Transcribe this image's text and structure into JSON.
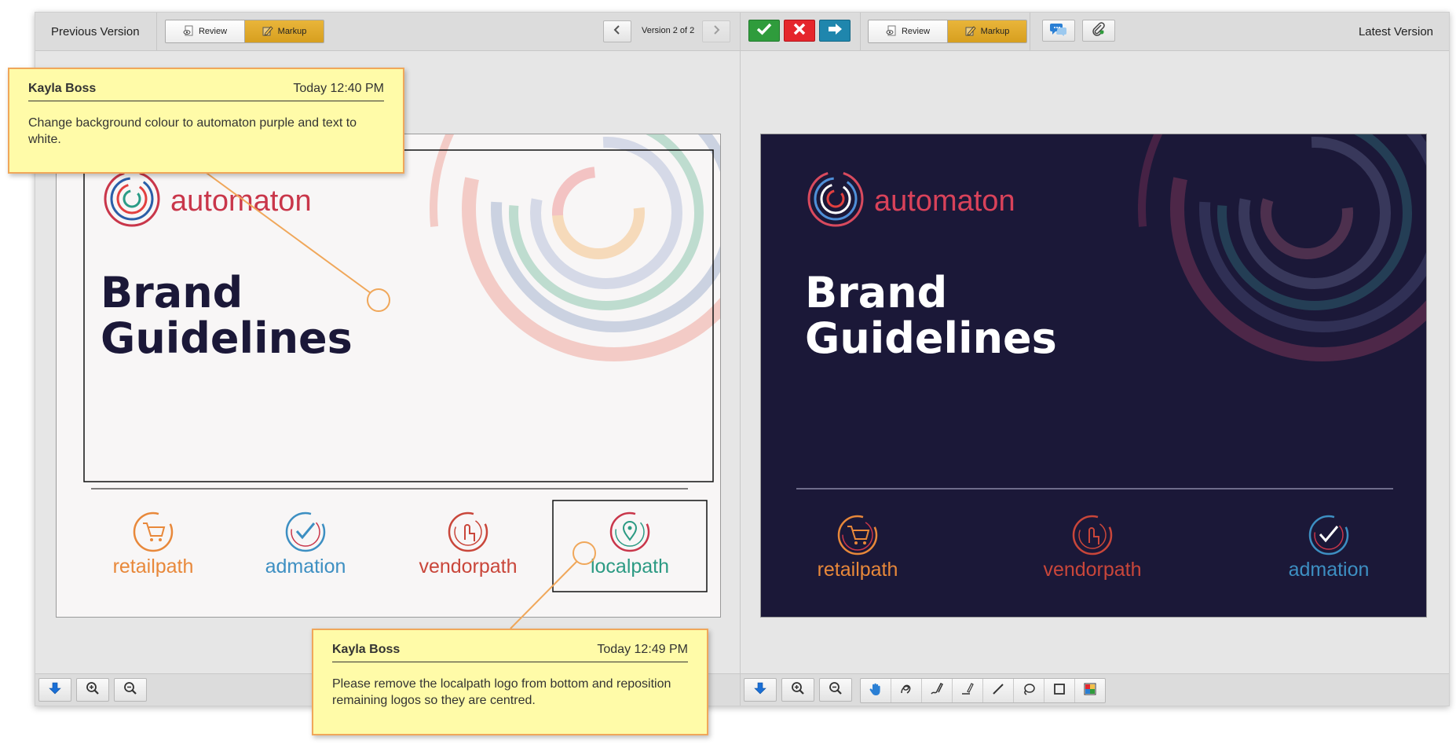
{
  "left_pane": {
    "title": "Previous Version",
    "review_label": "Review",
    "markup_label": "Markup",
    "version_label": "Version 2 of 2"
  },
  "right_pane": {
    "title": "Latest Version",
    "review_label": "Review",
    "markup_label": "Markup"
  },
  "artwork_previous": {
    "brand": "automaton",
    "heading_line1": "Brand",
    "heading_line2": "Guidelines",
    "logos": [
      "retailpath",
      "admation",
      "vendorpath",
      "localpath"
    ]
  },
  "artwork_latest": {
    "brand": "automaton",
    "heading_line1": "Brand",
    "heading_line2": "Guidelines",
    "logos": [
      "retailpath",
      "vendorpath",
      "admation"
    ]
  },
  "comments": [
    {
      "author": "Kayla Boss",
      "time": "Today 12:40 PM",
      "text": "Change background colour to automaton purple and text to white."
    },
    {
      "author": "Kayla Boss",
      "time": "Today 12:49 PM",
      "text": "Please remove the localpath logo from bottom and reposition remaining logos so they are centred."
    }
  ],
  "colors": {
    "markup_active": "#d9a120",
    "approve": "#2f9c3c",
    "reject": "#e5262c",
    "next": "#1f86ad",
    "note_bg": "#fffba8",
    "note_border": "#f0a75a",
    "automaton_purple": "#1b1838",
    "retailpath": "#e8883a",
    "admation": "#3d8fc2",
    "vendorpath": "#c9463a",
    "localpath": "#2c9a83"
  },
  "icons": {
    "review": "eye-page-icon",
    "markup": "pencil-icon",
    "prev": "chevron-left-icon",
    "next_version": "chevron-right-icon",
    "approve": "checkmark-icon",
    "reject": "x-icon",
    "send": "arrow-right-icon",
    "comments": "chat-bubbles-icon",
    "attach": "paperclip-icon",
    "download": "download-arrow-icon",
    "zoom_in": "zoom-in-icon",
    "zoom_out": "zoom-out-icon",
    "pan": "hand-icon",
    "freehand": "freehand-icon",
    "pen": "pen-icon",
    "highlighter": "highlighter-icon",
    "line": "line-icon",
    "lasso": "lasso-icon",
    "rectangle": "rectangle-icon",
    "color": "color-picker-icon"
  }
}
